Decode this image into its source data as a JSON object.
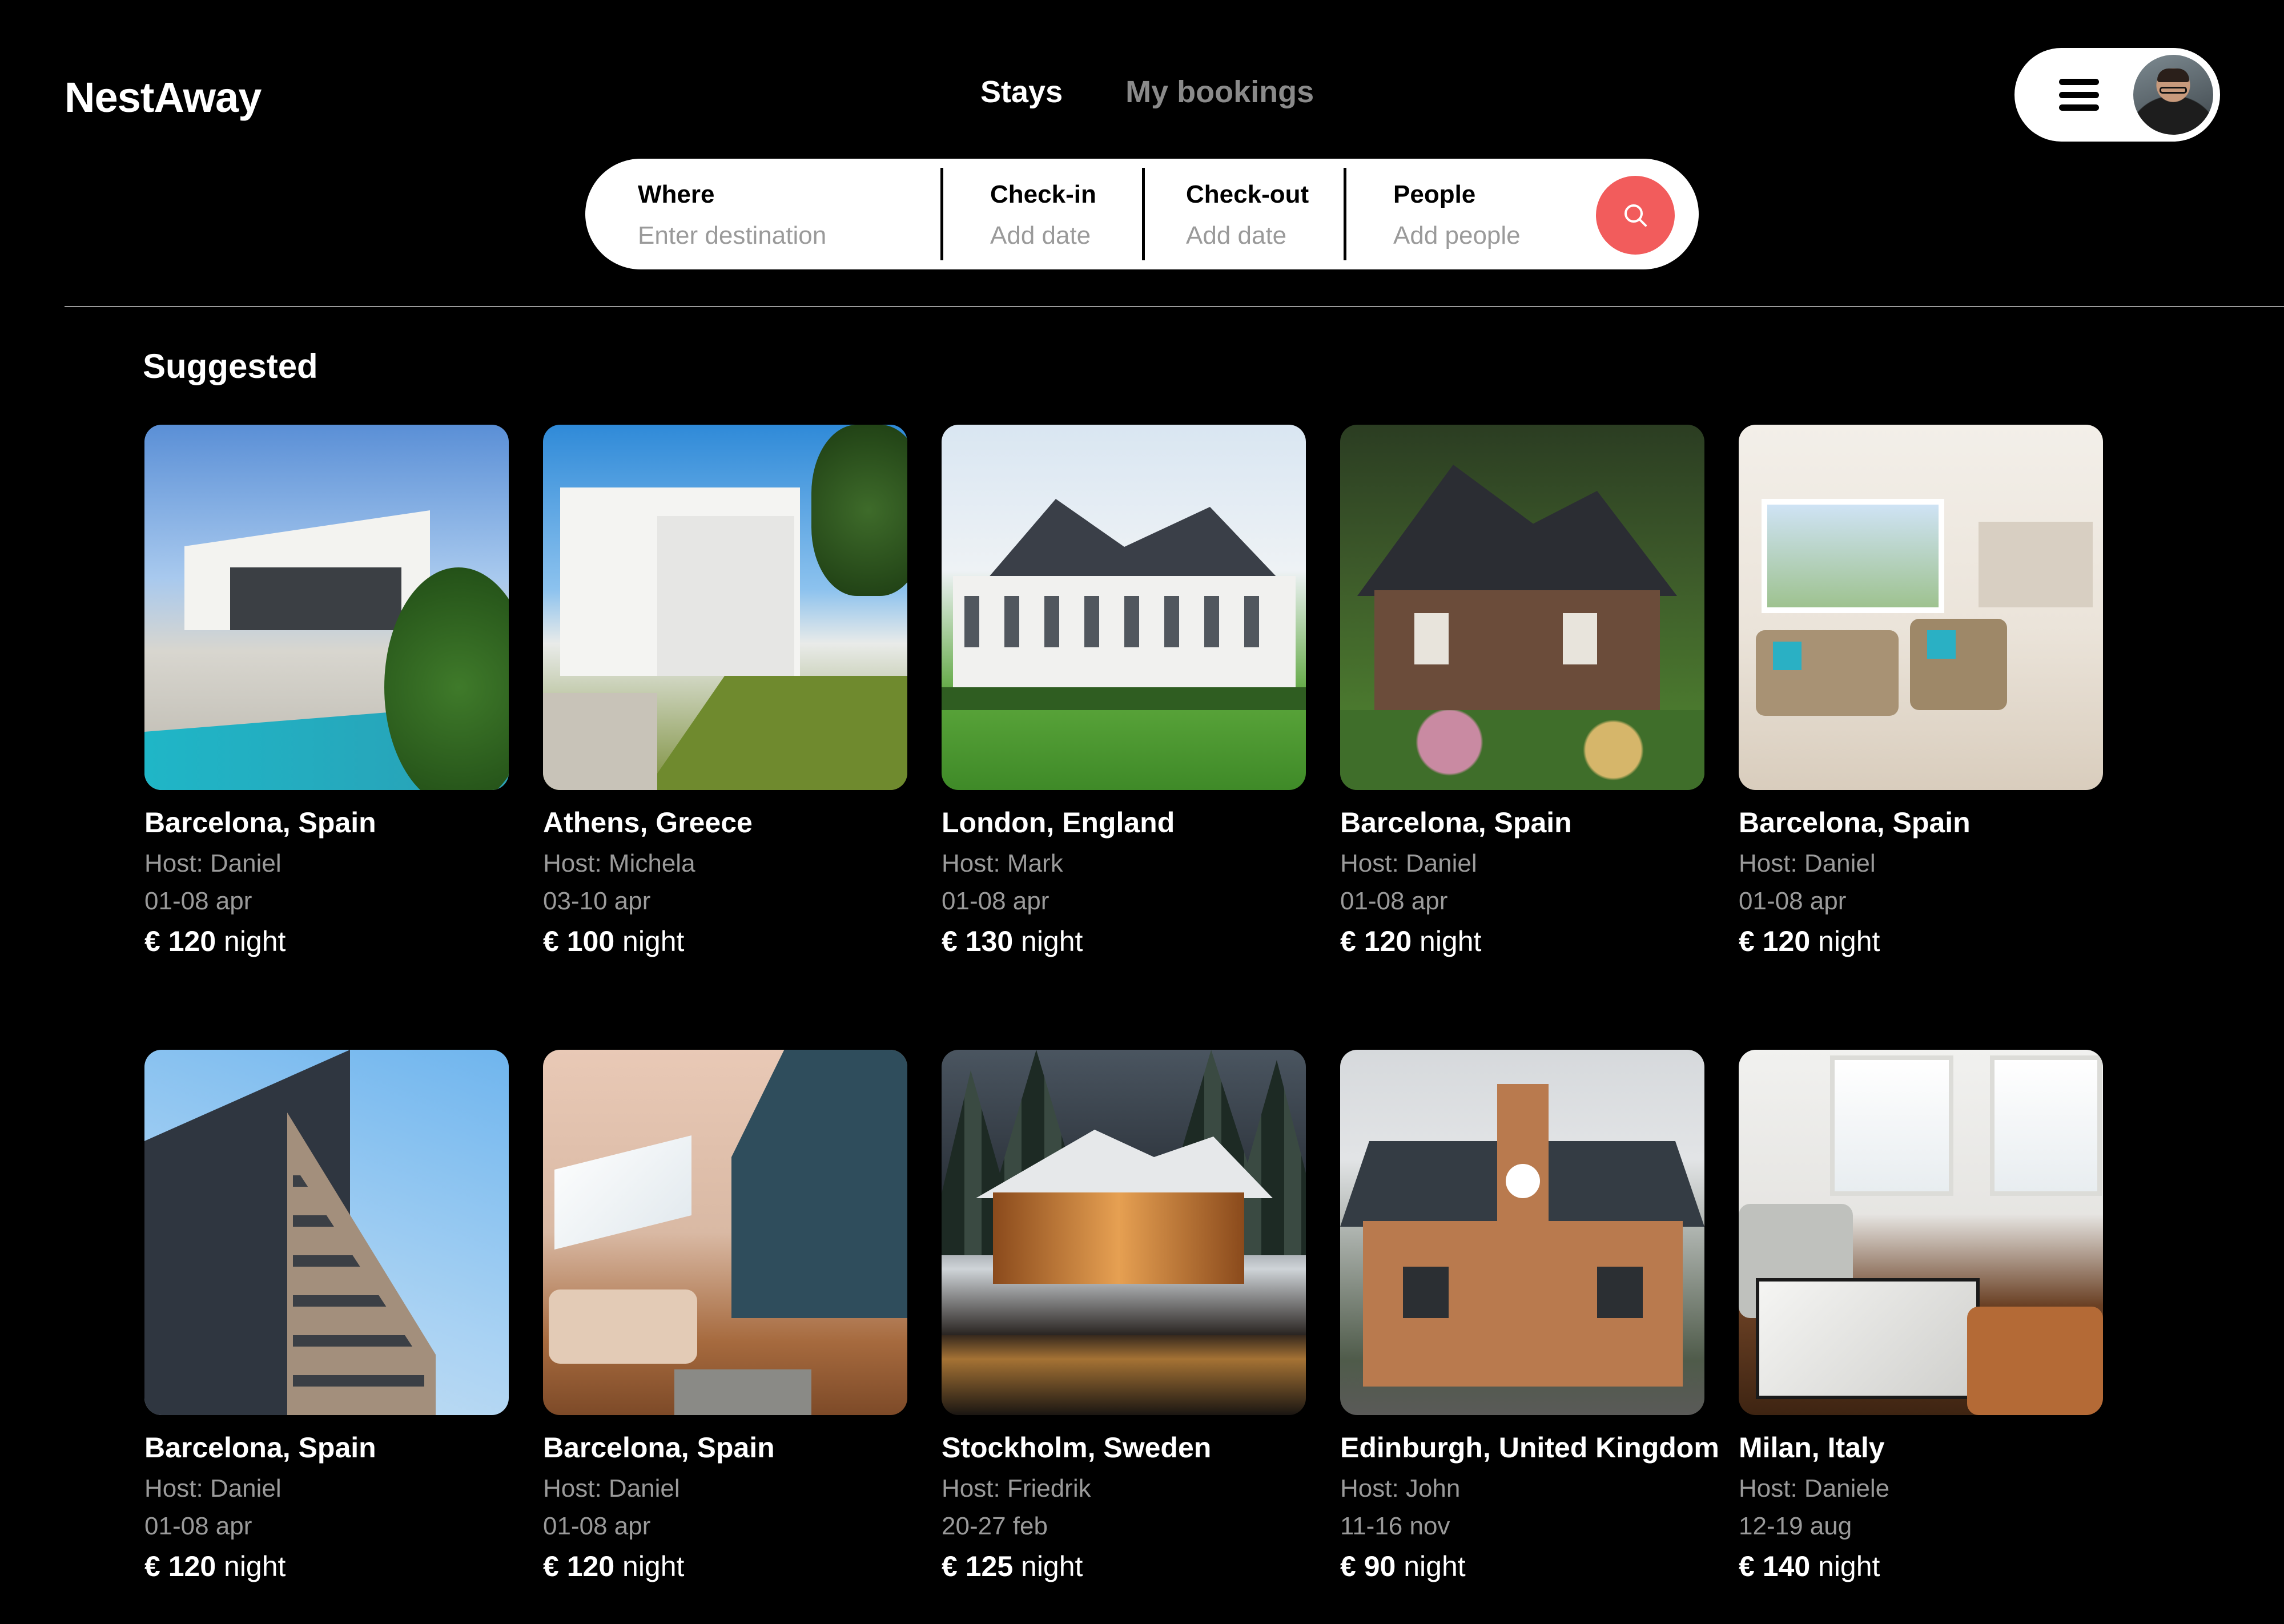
{
  "app": {
    "name": "NestAway"
  },
  "nav": {
    "tabs": [
      {
        "label": "Stays"
      },
      {
        "label": "My bookings"
      }
    ]
  },
  "search": {
    "fields": [
      {
        "label": "Where",
        "placeholder": "Enter destination"
      },
      {
        "label": "Check-in",
        "placeholder": "Add date"
      },
      {
        "label": "Check-out",
        "placeholder": "Add date"
      },
      {
        "label": "People",
        "placeholder": "Add people"
      }
    ]
  },
  "colors": {
    "accent": "#f25c5c",
    "background": "#000000"
  },
  "section": {
    "title": "Suggested"
  },
  "listings": [
    {
      "location": "Barcelona, Spain",
      "host": "Host: Daniel",
      "dates": "01-08 apr",
      "price": "€ 120",
      "unit": " night"
    },
    {
      "location": "Athens, Greece",
      "host": "Host: Michela",
      "dates": "03-10 apr",
      "price": "€ 100",
      "unit": " night"
    },
    {
      "location": "London, England",
      "host": "Host: Mark",
      "dates": "01-08 apr",
      "price": "€ 130",
      "unit": " night"
    },
    {
      "location": "Barcelona, Spain",
      "host": "Host: Daniel",
      "dates": "01-08 apr",
      "price": "€ 120",
      "unit": " night"
    },
    {
      "location": "Barcelona, Spain",
      "host": "Host: Daniel",
      "dates": "01-08 apr",
      "price": "€ 120",
      "unit": " night"
    },
    {
      "location": "Barcelona, Spain",
      "host": "Host: Daniel",
      "dates": "01-08 apr",
      "price": "€ 120",
      "unit": " night"
    },
    {
      "location": "Barcelona, Spain",
      "host": "Host: Daniel",
      "dates": "01-08 apr",
      "price": "€ 120",
      "unit": " night"
    },
    {
      "location": "Stockholm, Sweden",
      "host": "Host: Friedrik",
      "dates": "20-27 feb",
      "price": "€ 125",
      "unit": " night"
    },
    {
      "location": "Edinburgh, United Kingdom",
      "host": "Host: John",
      "dates": "11-16 nov",
      "price": "€ 90",
      "unit": " night"
    },
    {
      "location": "Milan, Italy",
      "host": "Host: Daniele",
      "dates": "12-19 aug",
      "price": "€ 140",
      "unit": " night"
    }
  ]
}
